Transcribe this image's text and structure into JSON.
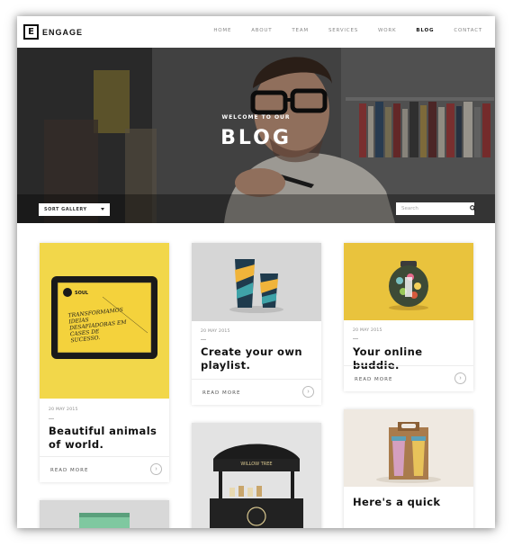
{
  "brand": {
    "logo_letter": "E",
    "name": "ENGAGE"
  },
  "nav": {
    "items": [
      "HOME",
      "ABOUT",
      "TEAM",
      "SERVICES",
      "WORK",
      "BLOG",
      "CONTACT"
    ],
    "active": "BLOG"
  },
  "hero": {
    "subtitle": "WELCOME TO OUR",
    "title": "BLOG"
  },
  "filters": {
    "sort_label": "SORT GALLERY",
    "search_placeholder": "Search"
  },
  "posts": [
    {
      "date": "20 MAY 2015",
      "title": "Beautiful animals of world.",
      "read_more": "READ MORE",
      "tablet_brand": "SOUL",
      "tablet_text": "TRANSFORMAMOS IDEIAS DESAFIADORAS EM CASES DE SUCESSO.",
      "image_bg": "#f2d74a"
    },
    {
      "date": "20 MAY 2015",
      "title": "Create your own playlist.",
      "read_more": "READ MORE",
      "image_bg": "#d6d6d6"
    },
    {
      "date": "20 MAY 2015",
      "title": "Your online buddie.",
      "read_more": "READ MORE",
      "image_bg": "#e9c33d"
    },
    {
      "title": "Here's a quick",
      "image_bg": "#efe9e1"
    }
  ],
  "colors": {
    "accent": "#f2d74a",
    "text": "#111111"
  },
  "icons": {
    "search": "search-icon",
    "arrow": "arrow-right-icon"
  }
}
